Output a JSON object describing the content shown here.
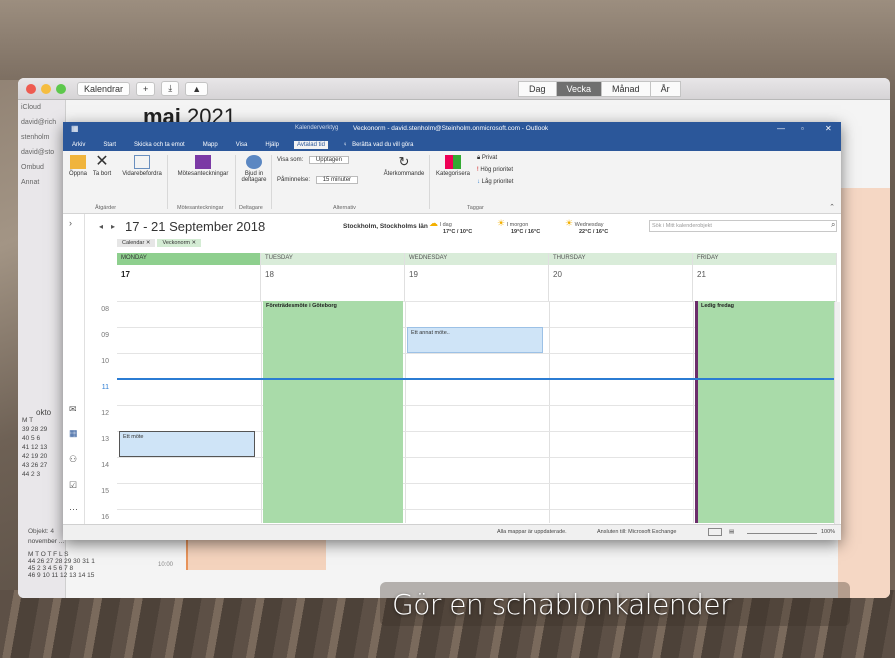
{
  "mac": {
    "toolbar": {
      "calendars_label": "Kalendrar",
      "add_label": "+",
      "share_icon": "⤓",
      "alert_icon": "▲"
    },
    "views": [
      "Dag",
      "Vecka",
      "Månad",
      "År"
    ],
    "active_view": "Vecka",
    "month_title": "maj",
    "year": "2021",
    "sidebar": [
      "iCloud",
      "david@rich",
      "stenholm",
      "david@sto",
      "Ombud",
      "Annat"
    ],
    "mini_cal_month": "okto",
    "mini_cal_weekdays": "M T",
    "mini_cal_rows": [
      "39 28 29",
      "40 5 6",
      "41 12 13",
      "42 19 20",
      "43 26 27",
      "44 2 3"
    ],
    "mini_cal2_title": "november ...",
    "mini_cal2_weekdays": "M T O T F L S",
    "mini_cal2_rows": [
      "44 26 27 28 29 30 31 1",
      "45 2 3 4 5 6 7 8",
      "46 9 10 11 12 13 14 15"
    ],
    "mini_time": "10:00"
  },
  "outlook": {
    "title": "Veckonorm - david.stenholm@Steinholm.onmicrosoft.com - Outlook",
    "title_tab": "Kalenderverktyg",
    "tabs": [
      "Arkiv",
      "Start",
      "Skicka och ta emot",
      "Mapp",
      "Visa",
      "Hjälp",
      "Avtalad tid"
    ],
    "active_tab": "Avtalad tid",
    "tell_me": "Berätta vad du vill göra",
    "ribbon": {
      "open": "Öppna",
      "delete": "Ta bort",
      "forward": "Vidarebefordra",
      "meeting_notes": "Mötesanteckningar",
      "invite": "Bjud in deltagare",
      "show_as": "Visa som:",
      "show_as_value": "Upptagen",
      "reminder": "Påminnelse:",
      "reminder_value": "15 minuter",
      "recurring": "Återkommande",
      "categorize": "Kategorisera",
      "private": "Privat",
      "high": "Hög prioritet",
      "low": "Låg prioritet",
      "group_actions": "Åtgärder",
      "group_notes": "Mötesanteckningar",
      "group_participants": "Deltagare",
      "group_options": "Alternativ",
      "group_tags": "Taggar"
    },
    "date_range": "17 - 21 September 2018",
    "location": "Stockholm, Stockholms län",
    "weather": [
      {
        "day": "I dag",
        "temp": "17°C / 10°C"
      },
      {
        "day": "I morgon",
        "temp": "19°C / 16°C"
      },
      {
        "day": "Wednesday",
        "temp": "22°C / 16°C"
      }
    ],
    "search_placeholder": "Sök i Mitt kalenderobjekt",
    "chips": [
      "Calendar",
      "Veckonorm"
    ],
    "days": [
      {
        "name": "MONDAY",
        "date": "17"
      },
      {
        "name": "TUESDAY",
        "date": "18"
      },
      {
        "name": "WEDNESDAY",
        "date": "19"
      },
      {
        "name": "THURSDAY",
        "date": "20"
      },
      {
        "name": "FRIDAY",
        "date": "21"
      }
    ],
    "hours": [
      "08",
      "09",
      "10",
      "11",
      "12",
      "13",
      "14",
      "15",
      "16"
    ],
    "events": {
      "tue": "Företrädesmöte i Göteborg",
      "wed": "Ett annat möte..",
      "mon": "Ett möte",
      "fri": "Ledig fredag"
    },
    "status": {
      "items": "Objekt: 4",
      "sync": "Alla mappar är uppdaterade.",
      "connected": "Ansluten till: Microsoft Exchange",
      "zoom": "100%"
    }
  },
  "caption": "Gör en schablonkalender",
  "colors": {
    "outlook_blue": "#2b579a",
    "event_green": "#a9dba9",
    "event_blue": "#cfe4f7",
    "friday_bar": "#6b2d6b"
  }
}
